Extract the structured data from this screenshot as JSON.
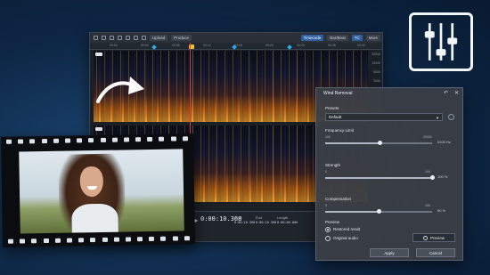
{
  "toolbar": {
    "upload_label": "Upload",
    "produce_label": "Produce",
    "timecode_btn": "Timecode",
    "bar_beat_btn": "Bar/Beat",
    "tc_label": "TC",
    "more_label": "More"
  },
  "ruler": {
    "ticks": [
      "00:00",
      "00:04",
      "00:08",
      "00:12",
      "00:16",
      "00:20",
      "00:24",
      "00:28",
      "00:32"
    ]
  },
  "scale": {
    "values": [
      "20000",
      "10000",
      "5000",
      "2000",
      "1000",
      "500",
      "200",
      "100"
    ]
  },
  "transport": {
    "timecode": "0:00:10.368",
    "start_label": "Start",
    "end_label": "End",
    "length_label": "Length",
    "start_val": "0:00:10.368",
    "end_val": "0:00:10.368",
    "length_val": "0:00:00.000"
  },
  "dialog": {
    "title": "Wind Removal",
    "presets_label": "Presets",
    "preset_value": "Default",
    "frequency_label": "Frequency Limit",
    "frequency_min": "100",
    "frequency_max": "20000",
    "frequency_readout": "5100 Hz",
    "frequency_level": 0.51,
    "strength_label": "Strength",
    "strength_min": "0",
    "strength_max": "100",
    "strength_readout": "100 %",
    "strength_level": 1.0,
    "compensation_label": "Compensation",
    "compensation_min": "0",
    "compensation_max": "100",
    "compensation_readout": "50 %",
    "compensation_level": 0.5,
    "preview_label": "Preview",
    "radio_restored": "Restored result",
    "radio_original": "Original audio",
    "preview_btn": "Preview",
    "apply_btn": "Apply",
    "cancel_btn": "Cancel"
  },
  "icons": [
    "arrow-icon",
    "mixer-sliders-icon",
    "play-icon",
    "reset-icon",
    "close-icon",
    "undo-icon"
  ]
}
